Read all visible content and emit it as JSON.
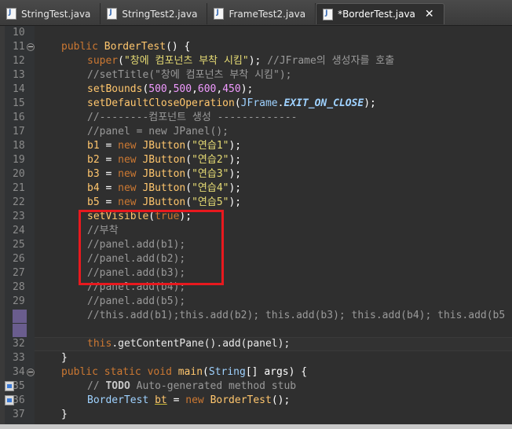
{
  "tabs": [
    {
      "label": "StringTest.java",
      "active": false
    },
    {
      "label": "StringTest2.java",
      "active": false
    },
    {
      "label": "FrameTest2.java",
      "active": false
    },
    {
      "label": "*BorderTest.java",
      "active": true
    }
  ],
  "lines": {
    "n10": "10",
    "n11": "11",
    "n12": "12",
    "n13": "13",
    "n14": "14",
    "n15": "15",
    "n16": "16",
    "n17": "17",
    "n18": "18",
    "n19": "19",
    "n20": "20",
    "n21": "21",
    "n22": "22",
    "n23": "23",
    "n24": "24",
    "n25": "25",
    "n26": "26",
    "n27": "27",
    "n28": "28",
    "n29": "29",
    "n32": "32",
    "n33": "33",
    "n34": "34",
    "n35": "35",
    "n36": "36",
    "n37": "37"
  },
  "code": {
    "l11": {
      "kw": "public",
      "name": "BorderTest",
      "rest": "() {"
    },
    "l12": {
      "super": "super",
      "open": "(",
      "str": "\"창에 컴포넌츠 부착 시킴\"",
      "close": ");",
      "cmt": "//JFrame의 생성자를 호출"
    },
    "l13": {
      "cmt": "//setTitle(\"창에 컴포넌츠 부착 시킴\");"
    },
    "l14": {
      "method": "setBounds",
      "open": "(",
      "n1": "500",
      "n2": "500",
      "n3": "600",
      "n4": "450",
      "comma": ",",
      "close": ");"
    },
    "l15": {
      "method": "setDefaultCloseOperation",
      "open": "(",
      "cls": "JFrame",
      "dot": ".",
      "constant": "EXIT_ON_CLOSE",
      "close": ");"
    },
    "l16": {
      "cmt": "//--------컴포넌트 생성 -------------"
    },
    "l17": {
      "cmt": "//panel = new JPanel();"
    },
    "l18": {
      "var": "b1",
      "eq": " = ",
      "kw": "new",
      "cls": "JButton",
      "open": "(",
      "str": "\"연습1\"",
      "close": ");"
    },
    "l19": {
      "var": "b2",
      "eq": " = ",
      "kw": "new",
      "cls": "JButton",
      "open": "(",
      "str": "\"연습2\"",
      "close": ");"
    },
    "l20": {
      "var": "b3",
      "eq": " = ",
      "kw": "new",
      "cls": "JButton",
      "open": "(",
      "str": "\"연습3\"",
      "close": ");"
    },
    "l21": {
      "var": "b4",
      "eq": " = ",
      "kw": "new",
      "cls": "JButton",
      "open": "(",
      "str": "\"연습4\"",
      "close": ");"
    },
    "l22": {
      "var": "b5",
      "eq": " = ",
      "kw": "new",
      "cls": "JButton",
      "open": "(",
      "str": "\"연습5\"",
      "close": ");"
    },
    "l23": {
      "method": "setVisible",
      "open": "(",
      "kw": "true",
      "close": ");"
    },
    "l24": {
      "cmt": "//부착"
    },
    "l25": {
      "cmt": "//panel.add(b1);"
    },
    "l26": {
      "cmt": "//panel.add(b2);"
    },
    "l27": {
      "cmt": "//panel.add(b3);"
    },
    "l28": {
      "cmt": "//panel.add(b4);"
    },
    "l29": {
      "cmt": "//panel.add(b5);"
    },
    "l30": {
      "cmt": "//this.add(b1);this.add(b2); this.add(b3); this.add(b4); this.add(b5"
    },
    "l32": {
      "kw": "this",
      "rest": ".getContentPane().add(panel);"
    },
    "l33": {
      "rest": "}"
    },
    "l34": {
      "kw1": "public",
      "kw2": "static",
      "kw3": "void",
      "method": "main",
      "open": "(",
      "cls": "String",
      "rest": "[] args) {"
    },
    "l35": {
      "prefix": "// ",
      "todo": "TODO",
      "cmt": " Auto-generated method stub"
    },
    "l36": {
      "cls": "BorderTest",
      "var": "bt",
      "eq": " = ",
      "kw": "new",
      "cls2": "BorderTest",
      "close": "();"
    },
    "l37": {
      "rest": "}"
    }
  },
  "colors": {
    "background": "#2f2f2f",
    "keyword": "#cc7832",
    "string": "#e6db74",
    "number": "#f09aff",
    "comment": "#9a9a9a",
    "highlight_box": "#e8191e"
  },
  "icons": {
    "file": "java-file-icon",
    "close": "close-icon",
    "fold": "fold-minus-icon",
    "marker": "task-marker-icon"
  }
}
